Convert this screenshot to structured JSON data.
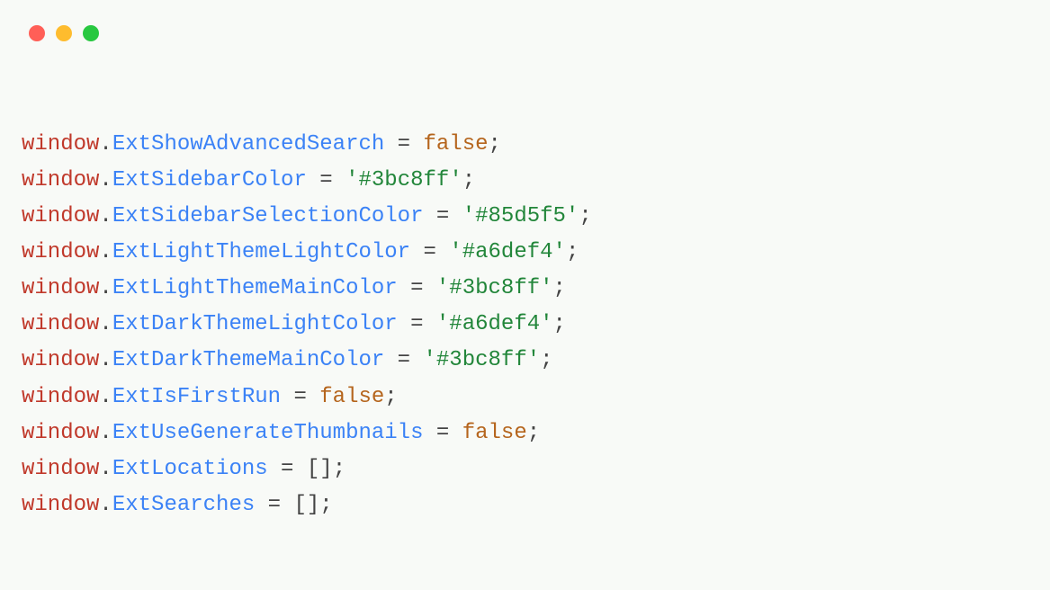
{
  "windowControls": {
    "red": "close",
    "yellow": "minimize",
    "green": "zoom"
  },
  "code": {
    "object": "window",
    "dot": ".",
    "assign": " = ",
    "semi": ";",
    "lbracket": "[",
    "rbracket": "]",
    "lines": [
      {
        "prop": "ExtShowAdvancedSearch",
        "valueType": "bool",
        "value": "false"
      },
      {
        "prop": "ExtSidebarColor",
        "valueType": "str",
        "value": "'#3bc8ff'"
      },
      {
        "prop": "ExtSidebarSelectionColor",
        "valueType": "str",
        "value": "'#85d5f5'"
      },
      {
        "prop": "ExtLightThemeLightColor",
        "valueType": "str",
        "value": "'#a6def4'"
      },
      {
        "prop": "ExtLightThemeMainColor",
        "valueType": "str",
        "value": "'#3bc8ff'"
      },
      {
        "prop": "ExtDarkThemeLightColor",
        "valueType": "str",
        "value": "'#a6def4'"
      },
      {
        "prop": "ExtDarkThemeMainColor",
        "valueType": "str",
        "value": "'#3bc8ff'"
      },
      {
        "prop": "ExtIsFirstRun",
        "valueType": "bool",
        "value": "false"
      },
      {
        "prop": "ExtUseGenerateThumbnails",
        "valueType": "bool",
        "value": "false"
      },
      {
        "prop": "ExtLocations",
        "valueType": "array",
        "value": ""
      },
      {
        "prop": "ExtSearches",
        "valueType": "array",
        "value": ""
      }
    ]
  }
}
